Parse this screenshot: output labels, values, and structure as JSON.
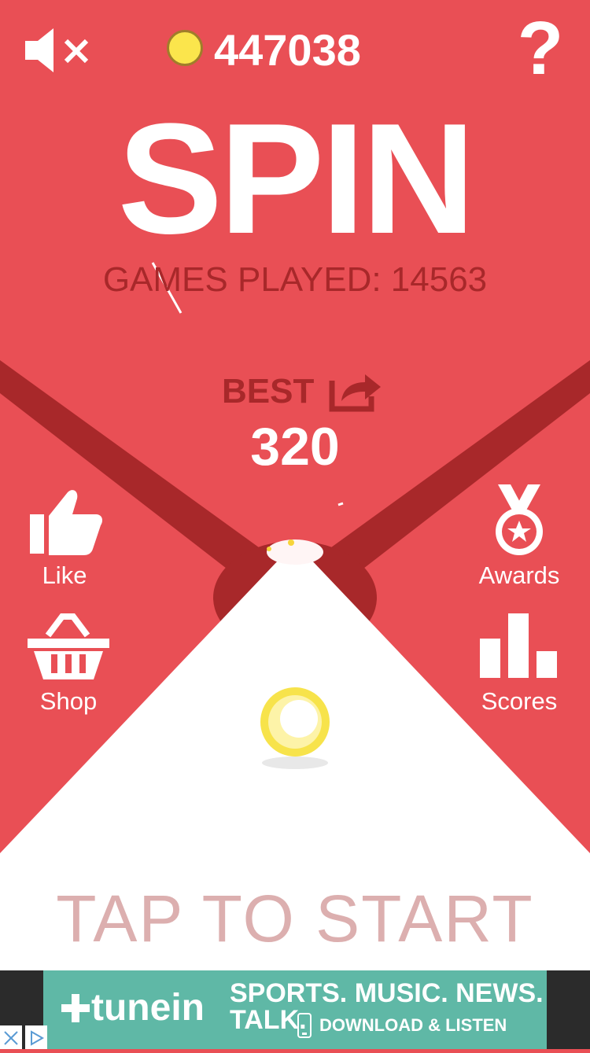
{
  "colors": {
    "background": "#e94f55",
    "dark_red": "#a8282a",
    "white": "#ffffff",
    "coin": "#fbe54c",
    "ad_teal": "#5fb8a6"
  },
  "top_bar": {
    "mute_icon": "speaker-muted-icon",
    "coin_icon": "coin-icon",
    "coins": "447038",
    "help_label": "?"
  },
  "title": "SPIN",
  "games_played": "GAMES PLAYED: 14563",
  "best": {
    "label": "BEST",
    "value": "320",
    "share_icon": "share-icon"
  },
  "left_menu": [
    {
      "label": "Like",
      "icon": "thumbs-up-icon"
    },
    {
      "label": "Shop",
      "icon": "basket-icon"
    }
  ],
  "right_menu": [
    {
      "label": "Awards",
      "icon": "medal-icon"
    },
    {
      "label": "Scores",
      "icon": "bar-chart-icon"
    }
  ],
  "tap_to_start": "TAP TO START",
  "ad": {
    "brand": "tunein",
    "headline": "SPORTS. MUSIC. NEWS. TALK.",
    "subline": "DOWNLOAD & LISTEN"
  }
}
